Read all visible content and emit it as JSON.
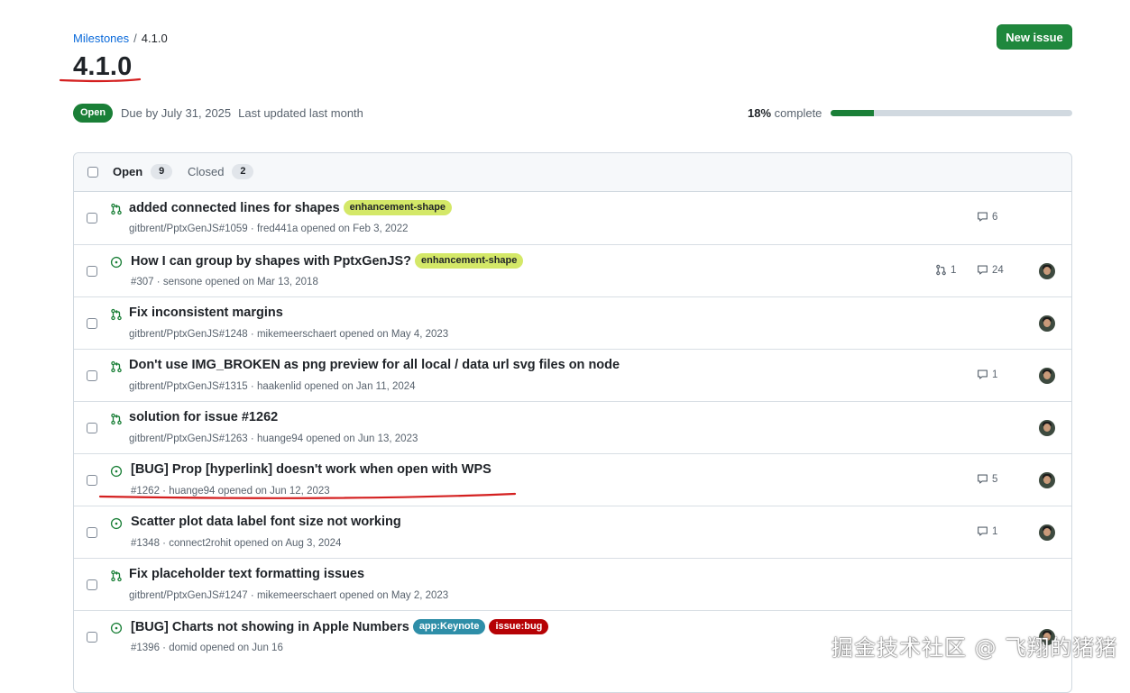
{
  "breadcrumb": {
    "parent": "Milestones",
    "separator": "/",
    "current": "4.1.0"
  },
  "title": "4.1.0",
  "new_issue_label": "New issue",
  "milestone": {
    "state": "Open",
    "due": "Due by July 31, 2025",
    "updated": "Last updated last month",
    "percent_label": "18%",
    "complete_label": "complete",
    "progress": 0.18
  },
  "tabs": {
    "open_label": "Open",
    "open_count": "9",
    "closed_label": "Closed",
    "closed_count": "2"
  },
  "colors": {
    "open_green": "#1a7f37",
    "button_green": "#1f883d",
    "link_blue": "#0969da",
    "annotation_red": "#d42020"
  },
  "items": [
    {
      "type": "pr",
      "title": "added connected lines for shapes",
      "ref": "gitbrent/PptxGenJS#1059",
      "author": "fred441a",
      "opened": "opened on Feb 3, 2022",
      "labels": [
        {
          "text": "enhancement-shape",
          "bg": "#d4e868",
          "fg": "#1f2328"
        }
      ],
      "comments": "6",
      "prs": "",
      "avatar": false
    },
    {
      "type": "issue",
      "title": "How I can group by shapes with PptxGenJS?",
      "ref": "#307",
      "author": "sensone",
      "opened": "opened on Mar 13, 2018",
      "labels": [
        {
          "text": "enhancement-shape",
          "bg": "#d4e868",
          "fg": "#1f2328"
        }
      ],
      "comments": "24",
      "prs": "1",
      "avatar": true
    },
    {
      "type": "pr",
      "title": "Fix inconsistent margins",
      "ref": "gitbrent/PptxGenJS#1248",
      "author": "mikemeerschaert",
      "opened": "opened on May 4, 2023",
      "labels": [],
      "comments": "",
      "prs": "",
      "avatar": true
    },
    {
      "type": "pr",
      "title": "Don't use IMG_BROKEN as png preview for all local / data url svg files on node",
      "ref": "gitbrent/PptxGenJS#1315",
      "author": "haakenlid",
      "opened": "opened on Jan 11, 2024",
      "labels": [],
      "comments": "1",
      "prs": "",
      "avatar": true
    },
    {
      "type": "pr",
      "title": "solution for issue #1262",
      "ref": "gitbrent/PptxGenJS#1263",
      "author": "huange94",
      "opened": "opened on Jun 13, 2023",
      "labels": [],
      "comments": "",
      "prs": "",
      "avatar": true
    },
    {
      "type": "issue",
      "title": "[BUG] Prop [hyperlink] doesn't work when open with WPS",
      "ref": "#1262",
      "author": "huange94",
      "opened": "opened on Jun 12, 2023",
      "labels": [],
      "comments": "5",
      "prs": "",
      "avatar": true
    },
    {
      "type": "issue",
      "title": "Scatter plot data label font size not working",
      "ref": "#1348",
      "author": "connect2rohit",
      "opened": "opened on Aug 3, 2024",
      "labels": [],
      "comments": "1",
      "prs": "",
      "avatar": true
    },
    {
      "type": "pr",
      "title": "Fix placeholder text formatting issues",
      "ref": "gitbrent/PptxGenJS#1247",
      "author": "mikemeerschaert",
      "opened": "opened on May 2, 2023",
      "labels": [],
      "comments": "",
      "prs": "",
      "avatar": false
    },
    {
      "type": "issue",
      "title": "[BUG] Charts not showing in Apple Numbers",
      "ref": "#1396",
      "author": "domid",
      "opened": "opened on Jun 16",
      "labels": [
        {
          "text": "app:Keynote",
          "bg": "#2e8ea8",
          "fg": "#ffffff"
        },
        {
          "text": "issue:bug",
          "bg": "#b60205",
          "fg": "#ffffff"
        }
      ],
      "comments": "",
      "prs": "",
      "avatar": true
    }
  ],
  "watermark": "掘金技术社区 @ 飞翔的猪猪"
}
